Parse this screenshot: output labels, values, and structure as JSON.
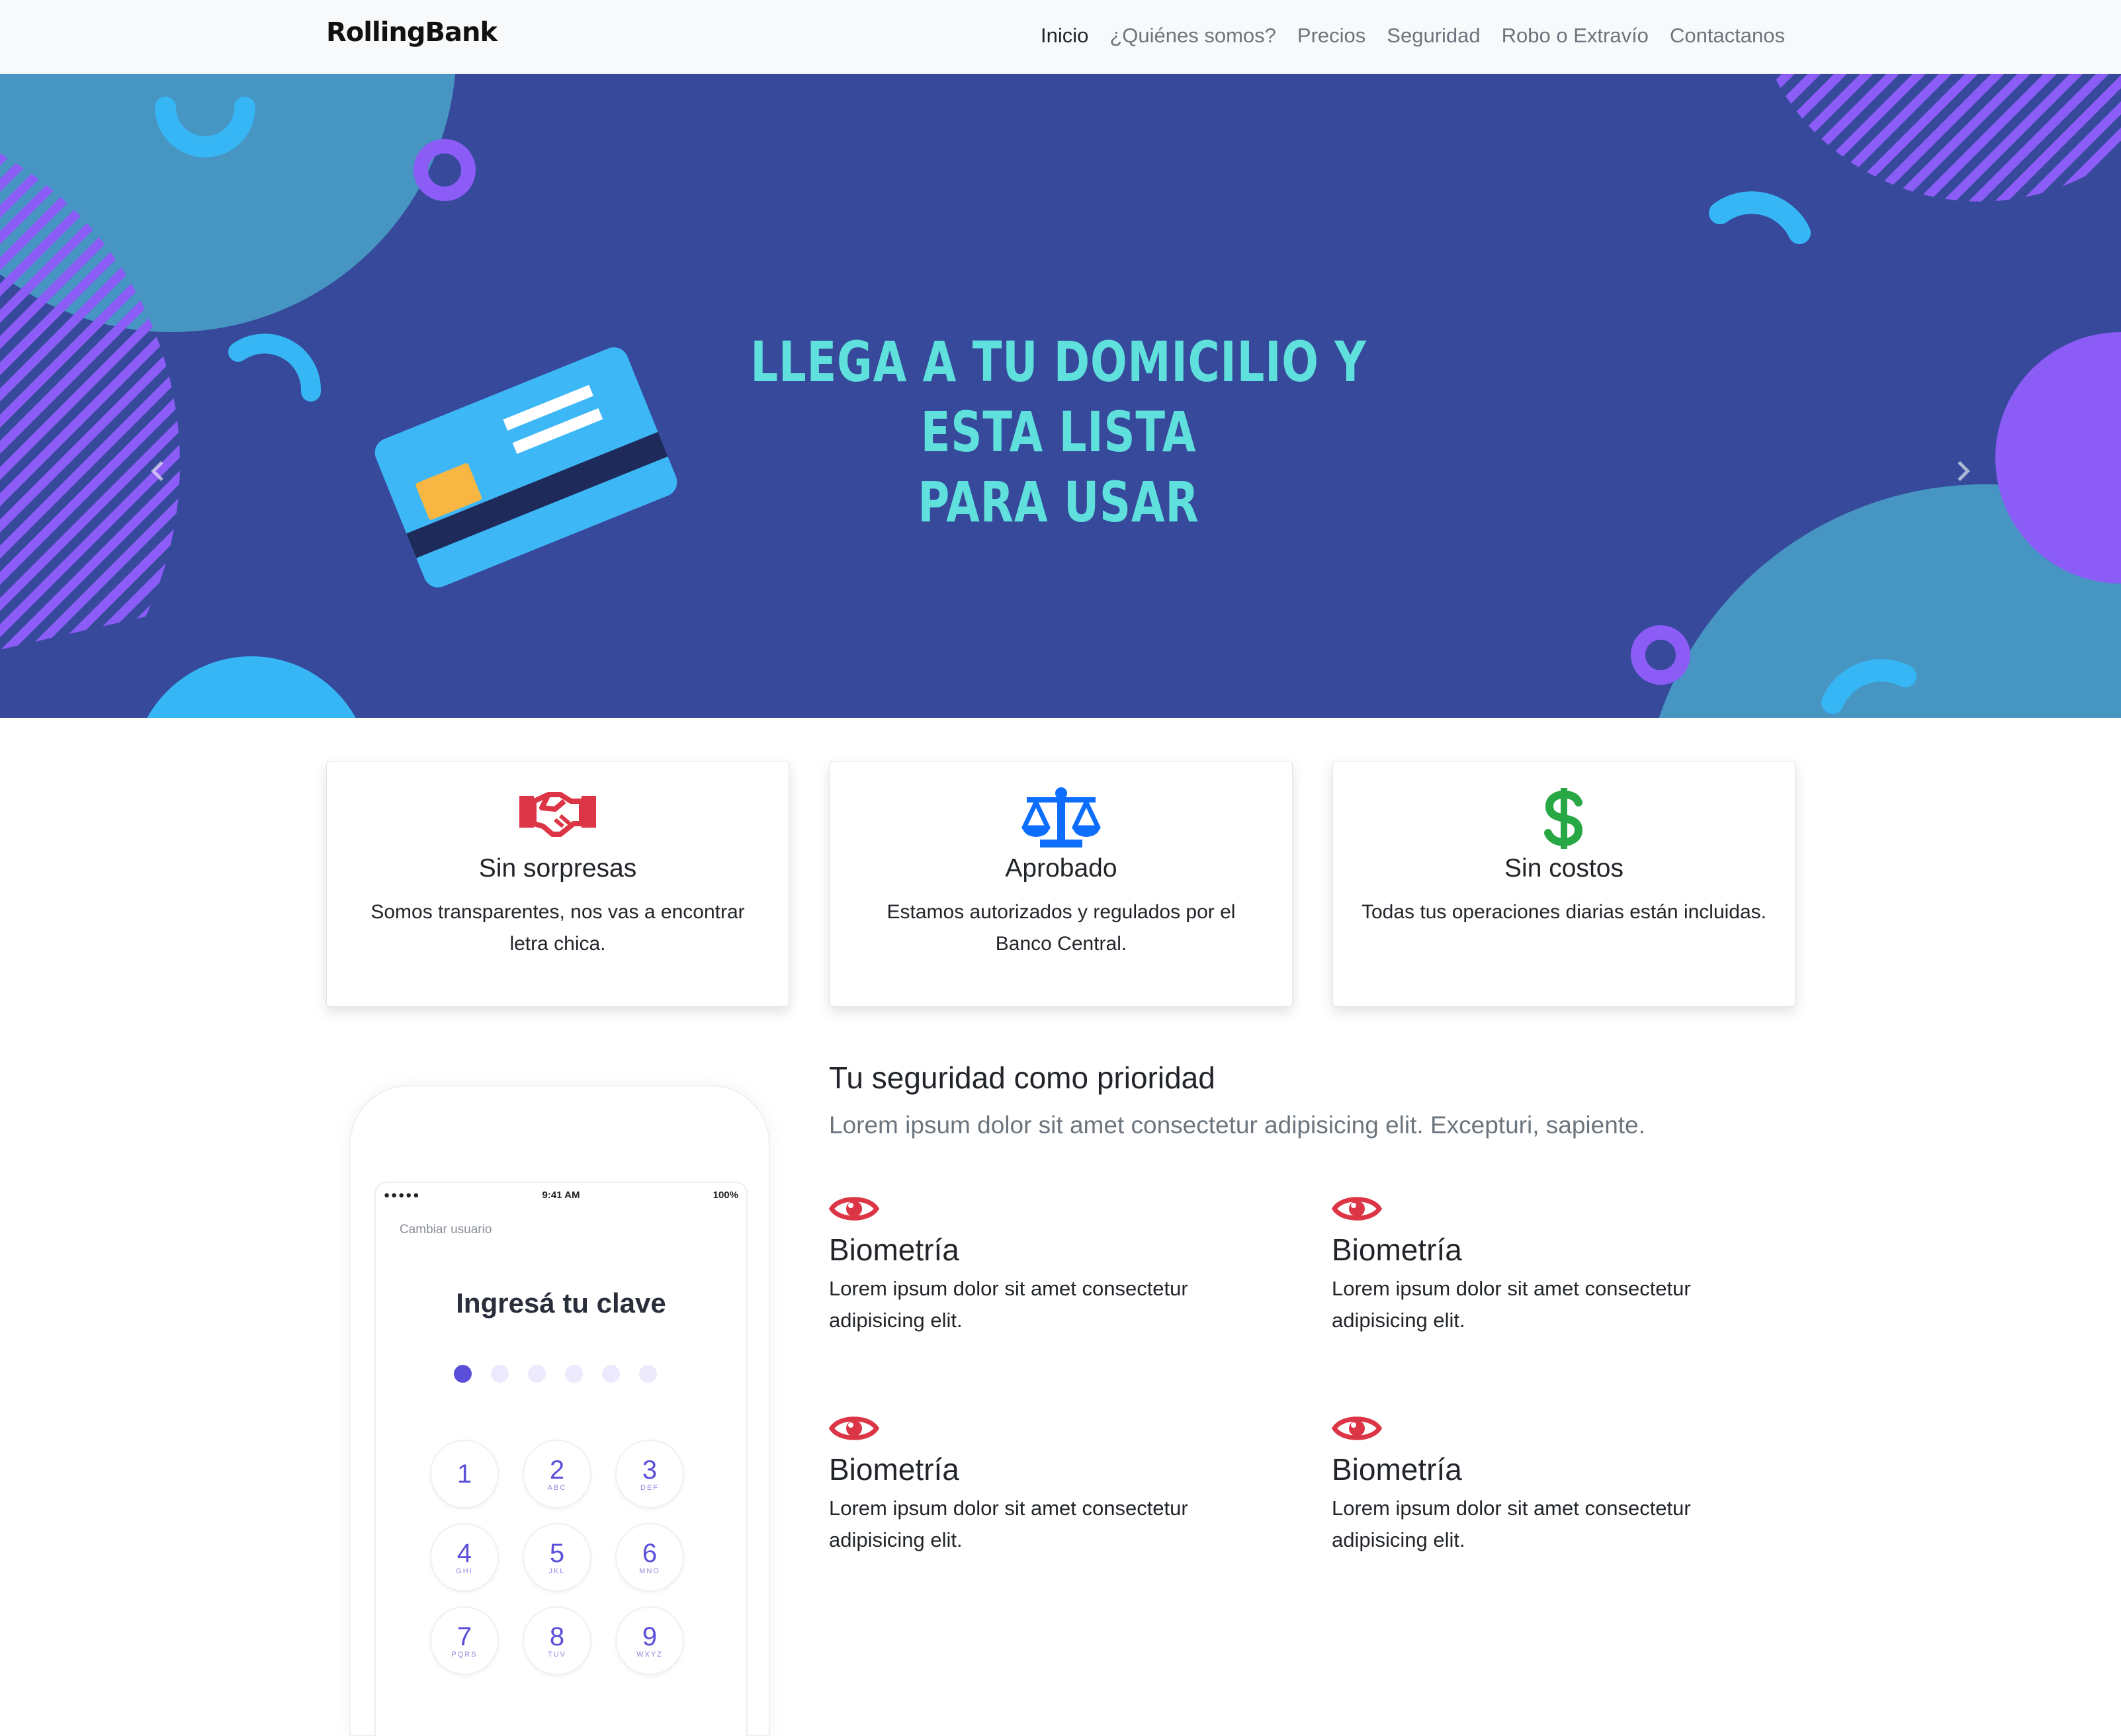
{
  "navbar": {
    "brand": "RollingBank",
    "links": [
      "Inicio",
      "¿Quiénes somos?",
      "Precios",
      "Seguridad",
      "Robo o Extravío",
      "Contactanos"
    ]
  },
  "hero": {
    "line1": "LLEGA A TU DOMICILIO Y ESTA LISTA",
    "line2": "PARA USAR",
    "active_slide": 2,
    "slide_count": 4
  },
  "cards": [
    {
      "title": "Sin sorpresas",
      "text": "Somos transparentes, nos vas a encontrar letra chica.",
      "icon": "handshake-icon",
      "color": "#dc3545"
    },
    {
      "title": "Aprobado",
      "text": "Estamos autorizados y regulados por el Banco Central.",
      "icon": "balance-scale-icon",
      "color": "#0d6efd"
    },
    {
      "title": "Sin costos",
      "text": "Todas tus operaciones diarias están incluidas.",
      "icon": "dollar-icon",
      "color": "#28a745"
    }
  ],
  "phone": {
    "time": "9:41 AM",
    "battery": "100%",
    "signal": "●●●●●",
    "cambiar": "Cambiar usuario",
    "title": "Ingresá tu clave",
    "pin_filled": 1,
    "pin_total": 6,
    "keys": [
      {
        "n": "1",
        "l": ""
      },
      {
        "n": "2",
        "l": "ABC"
      },
      {
        "n": "3",
        "l": "DEF"
      },
      {
        "n": "4",
        "l": "GHI"
      },
      {
        "n": "5",
        "l": "JKL"
      },
      {
        "n": "6",
        "l": "MNO"
      },
      {
        "n": "7",
        "l": "PQRS"
      },
      {
        "n": "8",
        "l": "TUV"
      },
      {
        "n": "9",
        "l": "WXYZ"
      }
    ]
  },
  "security": {
    "title": "Tu seguridad como prioridad",
    "lead": "Lorem ipsum dolor sit amet consectetur adipisicing elit. Excepturi, sapiente.",
    "features": [
      {
        "title": "Biometría",
        "text": "Lorem ipsum dolor sit amet consectetur adipisicing elit."
      },
      {
        "title": "Biometría",
        "text": "Lorem ipsum dolor sit amet consectetur adipisicing elit."
      },
      {
        "title": "Biometría",
        "text": "Lorem ipsum dolor sit amet consectetur adipisicing elit."
      },
      {
        "title": "Biometría",
        "text": "Lorem ipsum dolor sit amet consectetur adipisicing elit."
      }
    ],
    "eye_color": "#dc3545"
  }
}
